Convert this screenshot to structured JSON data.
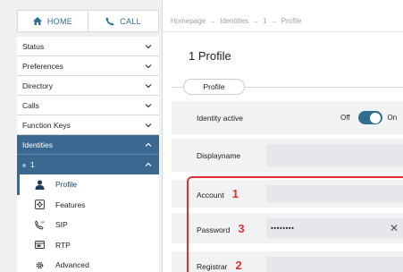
{
  "topbar": {
    "home_label": "HOME",
    "call_label": "CALL"
  },
  "breadcrumb": [
    "Homepage",
    "Identities",
    "1",
    "Profile"
  ],
  "page_title": "1  Profile",
  "tab": {
    "label": "Profile"
  },
  "sidebar": {
    "items": [
      {
        "label": "Status"
      },
      {
        "label": "Preferences"
      },
      {
        "label": "Directory"
      },
      {
        "label": "Calls"
      },
      {
        "label": "Function Keys"
      },
      {
        "label": "Identities"
      }
    ],
    "identity": {
      "label": "1"
    },
    "subitems": [
      {
        "label": "Profile",
        "icon": "person-icon"
      },
      {
        "label": "Features",
        "icon": "gear-box-icon"
      },
      {
        "label": "SIP",
        "icon": "phone-sip-icon"
      },
      {
        "label": "RTP",
        "icon": "rtp-icon"
      },
      {
        "label": "Advanced",
        "icon": "gear-icon"
      }
    ]
  },
  "form": {
    "identity_active": {
      "label": "Identity active",
      "off": "Off",
      "on": "On",
      "value": true
    },
    "displayname": {
      "label": "Displayname",
      "value": ""
    },
    "account": {
      "label": "Account",
      "marker": "1",
      "value": ""
    },
    "password": {
      "label": "Password",
      "marker": "3",
      "value": "••••••••"
    },
    "registrar": {
      "label": "Registrar",
      "marker": "2",
      "value": ""
    }
  },
  "colors": {
    "accent": "#2f6e8f",
    "selected": "#3a6891",
    "highlight": "#e0322d"
  }
}
